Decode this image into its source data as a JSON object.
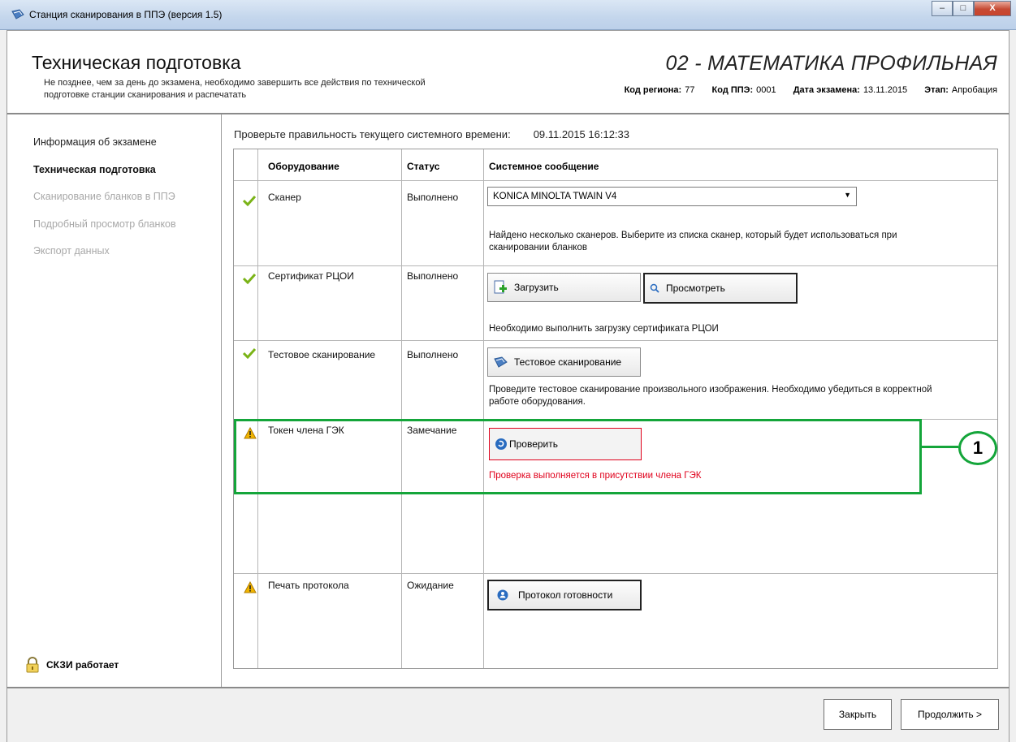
{
  "window": {
    "title": "Станция сканирования в ППЭ (версия 1.5)",
    "min": "–",
    "max": "□",
    "close": "X"
  },
  "header": {
    "title": "Техническая подготовка",
    "subtitle": "Не позднее, чем за день до экзамена, необходимо завершить все действия по технической подготовке станции сканирования и распечатать",
    "subject": "02 - МАТЕМАТИКА ПРОФИЛЬНАЯ",
    "meta": {
      "region_label": "Код региона:",
      "region_value": "77",
      "ppe_label": "Код ППЭ:",
      "ppe_value": "0001",
      "date_label": "Дата экзамена:",
      "date_value": "13.11.2015",
      "stage_label": "Этап:",
      "stage_value": "Апробация"
    }
  },
  "sidebar": {
    "items": [
      {
        "label": "Информация об экзамене",
        "state": "normal"
      },
      {
        "label": "Техническая подготовка",
        "state": "active"
      },
      {
        "label": "Сканирование бланков в ППЭ",
        "state": "disabled"
      },
      {
        "label": "Подробный просмотр бланков",
        "state": "disabled"
      },
      {
        "label": "Экспорт данных",
        "state": "disabled"
      }
    ],
    "skzi": "СКЗИ работает"
  },
  "main": {
    "time_label": "Проверьте правильность текущего системного времени:",
    "time_value": "09.11.2015 16:12:33",
    "columns": [
      "Оборудование",
      "Статус",
      "Системное сообщение"
    ],
    "rows": [
      {
        "equipment": "Сканер",
        "status": "Выполнено",
        "select_value": "KONICA MINOLTA TWAIN V4",
        "message": "Найдено несколько сканеров. Выберите из списка сканер, который будет использоваться при сканировании бланков"
      },
      {
        "equipment": "Сертификат РЦОИ",
        "status": "Выполнено",
        "button1": "Загрузить",
        "button2": "Просмотреть",
        "message": "Необходимо выполнить загрузку сертификата РЦОИ"
      },
      {
        "equipment": "Тестовое сканирование",
        "status": "Выполнено",
        "button": "Тестовое сканирование",
        "message": "Проведите тестовое сканирование произвольного изображения. Необходимо убедиться в корректной работе оборудования."
      },
      {
        "equipment": "Токен члена ГЭК",
        "status": "Замечание",
        "button": "Проверить",
        "message": "Проверка выполняется в присутствии члена ГЭК"
      },
      {
        "equipment": "Печать протокола",
        "status": "Ожидание",
        "button": "Протокол готовности"
      }
    ]
  },
  "annotation": {
    "number": "1",
    "color": "#14a53a"
  },
  "footer": {
    "close": "Закрыть",
    "continue": "Продолжить >"
  }
}
